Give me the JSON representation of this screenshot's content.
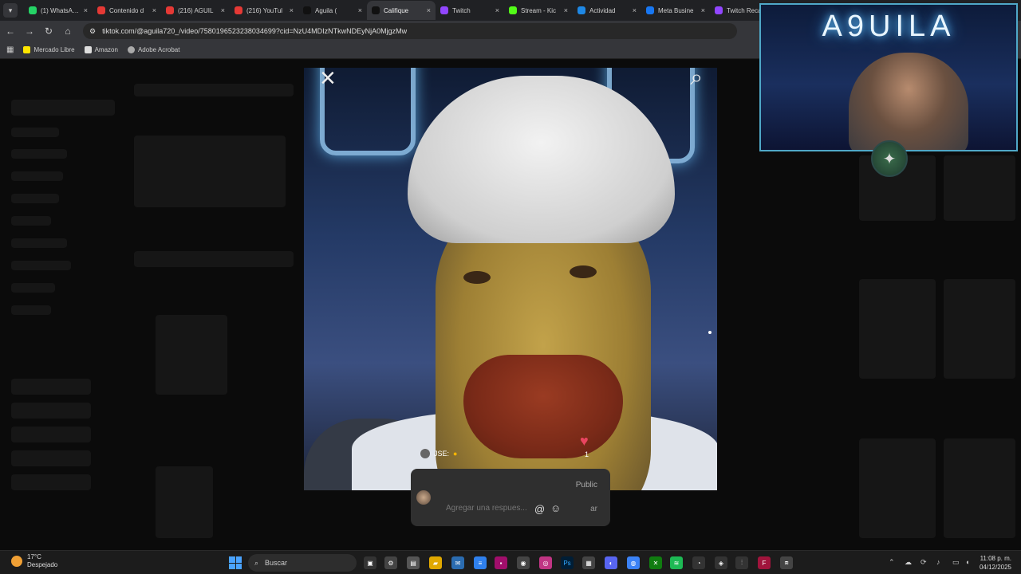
{
  "browser": {
    "tabs": [
      {
        "label": "(1) WhatsApp",
        "color": "#25d366",
        "active": false
      },
      {
        "label": "Contenido d",
        "color": "#e53935",
        "active": false
      },
      {
        "label": "(216) AGUIL",
        "color": "#e53935",
        "active": false
      },
      {
        "label": "(216) YouTul",
        "color": "#e53935",
        "active": false
      },
      {
        "label": "Aguila (",
        "color": "#111111",
        "active": false
      },
      {
        "label": "Califique",
        "color": "#111111",
        "active": true
      },
      {
        "label": "Twitch",
        "color": "#9146ff",
        "active": false
      },
      {
        "label": "Stream - Kic",
        "color": "#53fc18",
        "active": false
      },
      {
        "label": "Actividad",
        "color": "#1e88e5",
        "active": false
      },
      {
        "label": "Meta Busine",
        "color": "#1877f2",
        "active": false
      },
      {
        "label": "Twitch Reca",
        "color": "#9146ff",
        "active": false
      }
    ],
    "url": "tiktok.com/@aguila720_/video/7580196523238034699?cid=NzU4MDIzNTkwNDEyNjA0MjgzMw",
    "bookmarks": [
      "Mercado Libre",
      "Amazon",
      "Adobe Acrobat"
    ]
  },
  "video": {
    "reply_user": "JSE:",
    "likes": "1"
  },
  "reply_box": {
    "visibility": "Public",
    "placeholder": "Agregar una respues...",
    "post_label": "ar"
  },
  "overlay": {
    "webcam_title": "A9UILA"
  },
  "taskbar": {
    "temperature": "17°C",
    "weather": "Despejado",
    "search_label": "Buscar",
    "time": "11:08 p. m.",
    "date": "04/12/2025"
  }
}
